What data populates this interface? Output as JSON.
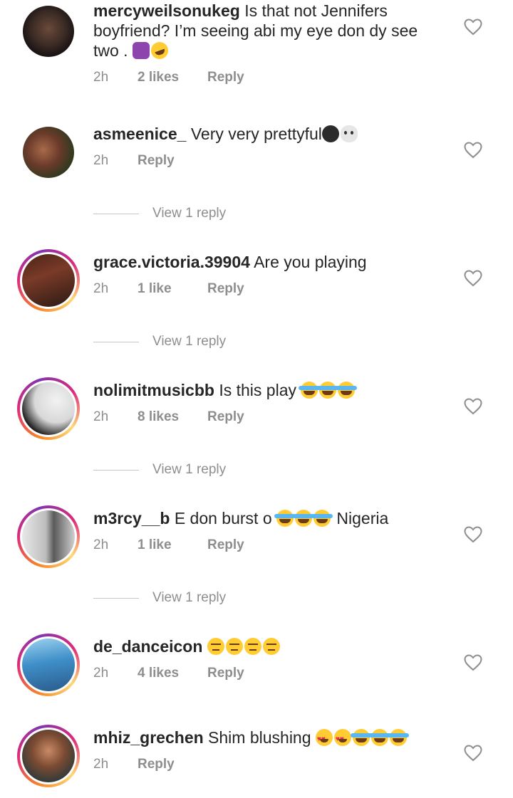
{
  "comments": [
    {
      "username": "mercyweilsonukeg",
      "text_line1": "Is that not Jennifers",
      "text_line2": "boyfriend? I’m seeing abi my eye don dy see",
      "text_line3": "two .",
      "emoji": [
        "woman-raising-hand",
        "rolling-on-floor-laughing"
      ],
      "time": "2h",
      "likes": "2 likes",
      "reply": "Reply"
    },
    {
      "username": "asmeenice_",
      "text": "Very very prettyful",
      "emoji": [
        "new-moon-face",
        "skull"
      ],
      "time": "2h",
      "reply": "Reply",
      "view_replies": "View 1 reply"
    },
    {
      "username": "grace.victoria.39904",
      "text": "Are you playing",
      "time": "2h",
      "likes": "1 like",
      "reply": "Reply",
      "view_replies": "View 1 reply"
    },
    {
      "username": "nolimitmusicbb",
      "text": "Is this play",
      "emoji": [
        "face-with-tears-of-joy",
        "face-with-tears-of-joy",
        "face-with-tears-of-joy"
      ],
      "time": "2h",
      "likes": "8 likes",
      "reply": "Reply",
      "view_replies": "View 1 reply"
    },
    {
      "username": "m3rcy__b",
      "text_before": "E don burst o",
      "text_after": "Nigeria",
      "emoji": [
        "face-with-tears-of-joy",
        "face-with-tears-of-joy",
        "face-with-tears-of-joy"
      ],
      "time": "2h",
      "likes": "1 like",
      "reply": "Reply",
      "view_replies": "View 1 reply"
    },
    {
      "username": "de_danceicon",
      "emoji": [
        "unamused-face",
        "unamused-face",
        "unamused-face",
        "unamused-face"
      ],
      "time": "2h",
      "likes": "4 likes",
      "reply": "Reply"
    },
    {
      "username": "mhiz_grechen",
      "text": "Shim blushing",
      "emoji": [
        "heart-eyes",
        "heart-eyes",
        "face-with-tears-of-joy",
        "face-with-tears-of-joy",
        "face-with-tears-of-joy"
      ],
      "time": "2h",
      "reply": "Reply"
    }
  ],
  "icons": {
    "like": "heart-outline-icon"
  },
  "colors": {
    "text": "#262626",
    "muted": "#8e8e8e",
    "story_ring": "#dd2a7b"
  }
}
